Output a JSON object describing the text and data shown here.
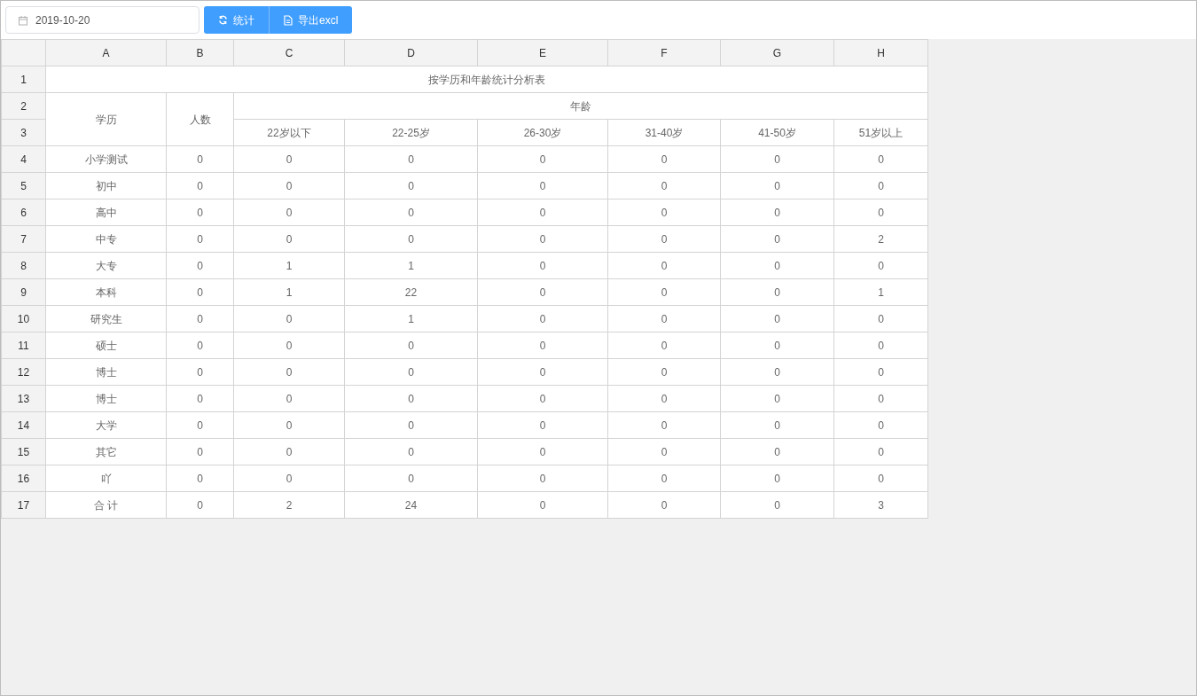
{
  "toolbar": {
    "date_field": {
      "value": "2019-10-20"
    },
    "buttons": [
      {
        "kind": "refresh",
        "label": "统计"
      },
      {
        "kind": "file",
        "label": "导出excl"
      }
    ]
  },
  "sheet": {
    "column_headers": [
      "A",
      "B",
      "C",
      "D",
      "E",
      "F",
      "G",
      "H"
    ],
    "row_numbers": [
      "1",
      "2",
      "3",
      "4",
      "5",
      "6",
      "7",
      "8",
      "9",
      "10",
      "11",
      "12",
      "13",
      "14",
      "15",
      "16",
      "17"
    ],
    "title": "按学历和年龄统计分析表",
    "header": {
      "education": "学历",
      "count": "人数",
      "age_group": "年龄",
      "age_ranges": [
        "22岁以下",
        "22-25岁",
        "26-30岁",
        "31-40岁",
        "41-50岁",
        "51岁以上"
      ]
    },
    "rows": [
      {
        "label": "小学测试",
        "values": [
          "0",
          "0",
          "0",
          "0",
          "0",
          "0",
          "0"
        ]
      },
      {
        "label": "初中",
        "values": [
          "0",
          "0",
          "0",
          "0",
          "0",
          "0",
          "0"
        ]
      },
      {
        "label": "高中",
        "values": [
          "0",
          "0",
          "0",
          "0",
          "0",
          "0",
          "0"
        ]
      },
      {
        "label": "中专",
        "values": [
          "0",
          "0",
          "0",
          "0",
          "0",
          "0",
          "2"
        ]
      },
      {
        "label": "大专",
        "values": [
          "0",
          "1",
          "1",
          "0",
          "0",
          "0",
          "0"
        ]
      },
      {
        "label": "本科",
        "values": [
          "0",
          "1",
          "22",
          "0",
          "0",
          "0",
          "1"
        ]
      },
      {
        "label": "研究生",
        "values": [
          "0",
          "0",
          "1",
          "0",
          "0",
          "0",
          "0"
        ]
      },
      {
        "label": "硕士",
        "values": [
          "0",
          "0",
          "0",
          "0",
          "0",
          "0",
          "0"
        ]
      },
      {
        "label": "博士",
        "values": [
          "0",
          "0",
          "0",
          "0",
          "0",
          "0",
          "0"
        ]
      },
      {
        "label": "博士",
        "values": [
          "0",
          "0",
          "0",
          "0",
          "0",
          "0",
          "0"
        ]
      },
      {
        "label": "大学",
        "values": [
          "0",
          "0",
          "0",
          "0",
          "0",
          "0",
          "0"
        ]
      },
      {
        "label": "其它",
        "values": [
          "0",
          "0",
          "0",
          "0",
          "0",
          "0",
          "0"
        ]
      },
      {
        "label": "吖",
        "values": [
          "0",
          "0",
          "0",
          "0",
          "0",
          "0",
          "0"
        ]
      },
      {
        "label": "合 计",
        "values": [
          "0",
          "2",
          "24",
          "0",
          "0",
          "0",
          "3"
        ]
      }
    ]
  }
}
